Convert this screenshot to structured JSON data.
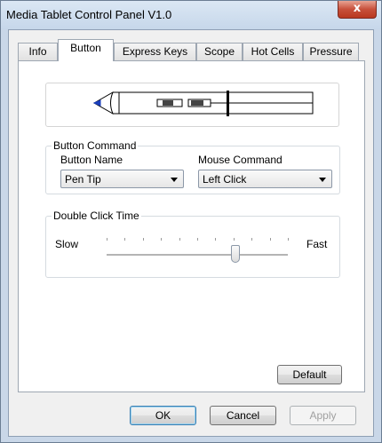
{
  "window": {
    "title": "Media Tablet Control Panel V1.0",
    "close_glyph": "x"
  },
  "tabs": [
    {
      "label": "Info"
    },
    {
      "label": "Button",
      "selected": true
    },
    {
      "label": "Express Keys"
    },
    {
      "label": "Scope"
    },
    {
      "label": "Hot Cells"
    },
    {
      "label": "Pressure"
    }
  ],
  "button_command": {
    "group_label": "Button Command",
    "button_name_label": "Button Name",
    "button_name_value": "Pen Tip",
    "mouse_command_label": "Mouse Command",
    "mouse_command_value": "Left Click"
  },
  "double_click": {
    "group_label": "Double Click Time",
    "slow_label": "Slow",
    "fast_label": "Fast",
    "slider_fraction": 0.71
  },
  "buttons": {
    "default": "Default",
    "ok": "OK",
    "cancel": "Cancel",
    "apply": "Apply"
  },
  "colors": {
    "pen_tip": "#1b3fbd",
    "close_button": "#c7503b"
  }
}
